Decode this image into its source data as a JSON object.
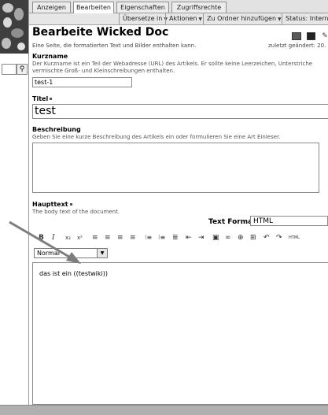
{
  "tabs": [
    "Anzeigen",
    "Bearbeiten",
    "Eigenschaften",
    "Zugriffsrechte"
  ],
  "actions": [
    "Übersetze in",
    "Aktionen",
    "Zu Ordner hinzufügen",
    "Status: Intern s"
  ],
  "doc": {
    "title": "Bearbeite Wicked Doc",
    "description": "Eine Seite, die formatierten Text und Bilder enthalten kann.",
    "last_modified": "zuletzt geändert: 20."
  },
  "fields": {
    "shortname": {
      "label": "Kurzname",
      "help_line1": "Der Kurzname ist ein Teil der Webadresse (URL) des Artikels. Er sollte keine Leerzeichen, Unterstriche",
      "help_line2": "vermischte Groß- und Kleinschreibungen enthalten.",
      "value": "test-1"
    },
    "title": {
      "label": "Titel",
      "value": "test"
    },
    "description": {
      "label": "Beschreibung",
      "help": "Geben Sie eine kurze Beschreibung des Artikels ein oder formulieren Sie eine Art Einleser.",
      "value": ""
    },
    "body": {
      "label": "Haupttext",
      "help": "The body text of the document.",
      "text_format_label": "Text Format",
      "text_format_value": "HTML",
      "paragraph_style": "Normal",
      "content": "das ist ein ((testwiki))"
    }
  },
  "toolbar": {
    "bold": "B",
    "italic": "I",
    "subscript": "x₂",
    "superscript": "x²",
    "align_left": "≡",
    "align_center": "≡",
    "align_right": "≡",
    "justify": "≡",
    "ordered_list": "⁝≡",
    "unordered_list": "⁝≡",
    "definition_list": "≣",
    "outdent": "⇤",
    "indent": "⇥",
    "insert_image": "▣",
    "insert_link": "∞",
    "anchor": "⊕",
    "table": "⊞",
    "undo": "↶",
    "redo": "↷",
    "html_source": "HTML"
  }
}
